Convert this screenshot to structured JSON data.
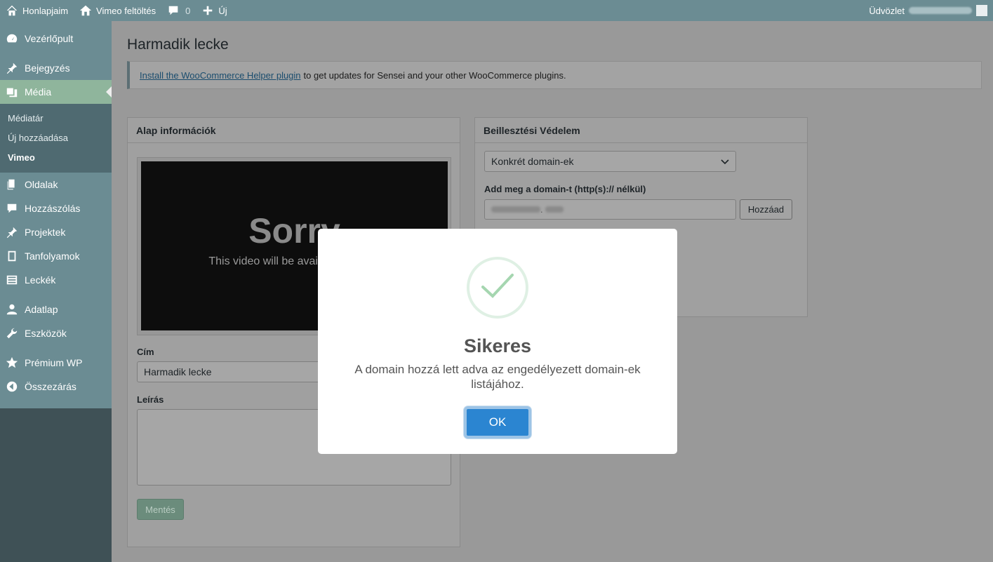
{
  "adminbar": {
    "site_label": "Honlapjaim",
    "upload_label": "Vimeo feltöltés",
    "comments_count": "0",
    "new_label": "Új",
    "greeting": "Üdvözlet"
  },
  "sidebar": {
    "items": [
      {
        "label": "Vezérlőpult",
        "icon": "dashboard-icon"
      },
      {
        "label": "Bejegyzés",
        "icon": "pin-icon"
      },
      {
        "label": "Média",
        "icon": "media-icon"
      },
      {
        "label": "Oldalak",
        "icon": "pages-icon"
      },
      {
        "label": "Hozzászólás",
        "icon": "comment-icon"
      },
      {
        "label": "Projektek",
        "icon": "pin-icon"
      },
      {
        "label": "Tanfolyamok",
        "icon": "book-icon"
      },
      {
        "label": "Leckék",
        "icon": "list-icon"
      },
      {
        "label": "Adatlap",
        "icon": "user-icon"
      },
      {
        "label": "Eszközök",
        "icon": "wrench-icon"
      },
      {
        "label": "Prémium WP",
        "icon": "star-icon"
      },
      {
        "label": "Összezárás",
        "icon": "collapse-icon"
      }
    ],
    "submenu": [
      "Médiatár",
      "Új hozzáadása",
      "Vimeo"
    ]
  },
  "page": {
    "title": "Harmadik lecke",
    "notice_link": "Install the WooCommerce Helper plugin",
    "notice_text": "to get updates for Sensei and your other WooCommerce plugins."
  },
  "basic_box": {
    "heading": "Alap információk",
    "video_title": "Sorry",
    "video_message": "This video will be available shortly.",
    "title_label": "Cím",
    "title_value": "Harmadik lecke",
    "description_label": "Leírás",
    "description_value": "",
    "save_label": "Mentés"
  },
  "embed_box": {
    "heading": "Beillesztési Védelem",
    "select_value": "Konkrét domain-ek",
    "domain_label": "Add meg a domain-t (http(s):// nélkül)",
    "domain_dot": ".",
    "add_label": "Hozzáad"
  },
  "modal": {
    "title": "Sikeres",
    "text": "A domain hozzá lett adva az engedélyezett domain-ek listájához.",
    "ok_label": "OK"
  },
  "colors": {
    "adminbar": "#6b8c93",
    "menu_active": "#8fb59c",
    "ok_button": "#2b85d1",
    "check": "#a5d6b0"
  }
}
